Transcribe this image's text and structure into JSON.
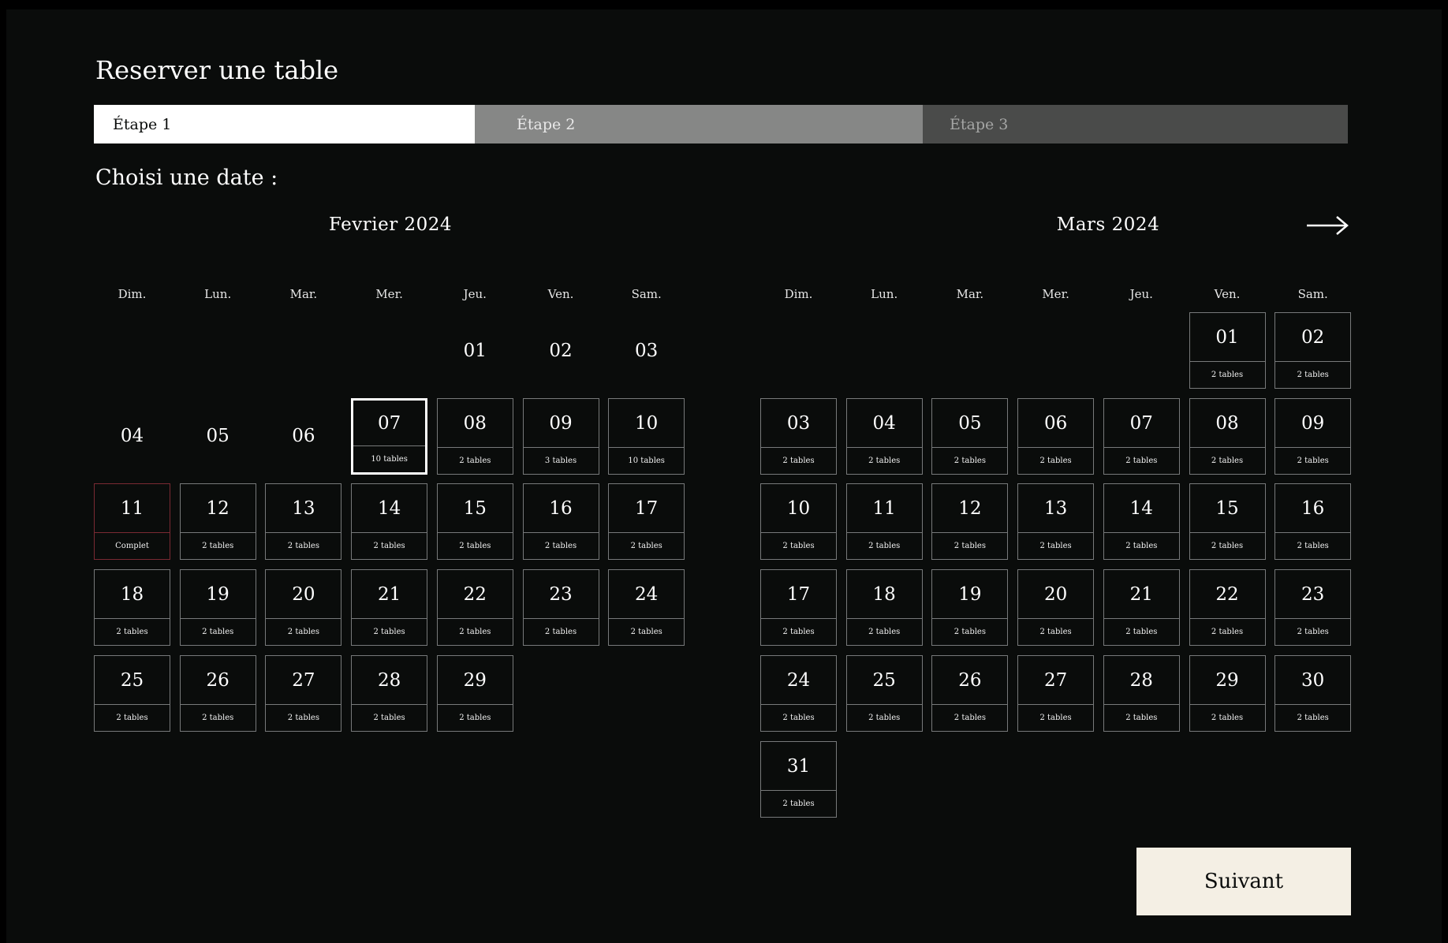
{
  "page": {
    "title": "Reserver une table",
    "subtitle": "Choisi une date :"
  },
  "steps": [
    {
      "label": "Étape 1",
      "state": "active"
    },
    {
      "label": "Étape 2",
      "state": "pending"
    },
    {
      "label": "Étape 3",
      "state": "pending"
    }
  ],
  "colors": {
    "background": "#0a0c0b",
    "cell_border": "#77797a",
    "full_border": "#7a2a33",
    "button_bg": "#f4efe4"
  },
  "calendar": {
    "weekdays": [
      "Dim.",
      "Lun.",
      "Mar.",
      "Mer.",
      "Jeu.",
      "Ven.",
      "Sam."
    ],
    "next_icon": "arrow-right-icon",
    "months": [
      {
        "title": "Fevrier 2024",
        "first_weekday": 4,
        "days": [
          {
            "day": "01",
            "available": false
          },
          {
            "day": "02",
            "available": false
          },
          {
            "day": "03",
            "available": false
          },
          {
            "day": "04",
            "available": false
          },
          {
            "day": "05",
            "available": false
          },
          {
            "day": "06",
            "available": false
          },
          {
            "day": "07",
            "status": "10 tables",
            "selected": true
          },
          {
            "day": "08",
            "status": "2 tables"
          },
          {
            "day": "09",
            "status": "3 tables"
          },
          {
            "day": "10",
            "status": "10 tables"
          },
          {
            "day": "11",
            "status": "Complet",
            "full": true
          },
          {
            "day": "12",
            "status": "2 tables"
          },
          {
            "day": "13",
            "status": "2 tables"
          },
          {
            "day": "14",
            "status": "2 tables"
          },
          {
            "day": "15",
            "status": "2 tables"
          },
          {
            "day": "16",
            "status": "2 tables"
          },
          {
            "day": "17",
            "status": "2 tables"
          },
          {
            "day": "18",
            "status": "2 tables"
          },
          {
            "day": "19",
            "status": "2 tables"
          },
          {
            "day": "20",
            "status": "2 tables"
          },
          {
            "day": "21",
            "status": "2 tables"
          },
          {
            "day": "22",
            "status": "2 tables"
          },
          {
            "day": "23",
            "status": "2 tables"
          },
          {
            "day": "24",
            "status": "2 tables"
          },
          {
            "day": "25",
            "status": "2 tables"
          },
          {
            "day": "26",
            "status": "2 tables"
          },
          {
            "day": "27",
            "status": "2 tables"
          },
          {
            "day": "28",
            "status": "2 tables"
          },
          {
            "day": "29",
            "status": "2 tables"
          }
        ]
      },
      {
        "title": "Mars 2024",
        "first_weekday": 5,
        "days": [
          {
            "day": "01",
            "status": "2 tables"
          },
          {
            "day": "02",
            "status": "2 tables"
          },
          {
            "day": "03",
            "status": "2 tables"
          },
          {
            "day": "04",
            "status": "2 tables"
          },
          {
            "day": "05",
            "status": "2 tables"
          },
          {
            "day": "06",
            "status": "2 tables"
          },
          {
            "day": "07",
            "status": "2 tables"
          },
          {
            "day": "08",
            "status": "2 tables"
          },
          {
            "day": "09",
            "status": "2 tables"
          },
          {
            "day": "10",
            "status": "2 tables"
          },
          {
            "day": "11",
            "status": "2 tables"
          },
          {
            "day": "12",
            "status": "2 tables"
          },
          {
            "day": "13",
            "status": "2 tables"
          },
          {
            "day": "14",
            "status": "2 tables"
          },
          {
            "day": "15",
            "status": "2 tables"
          },
          {
            "day": "16",
            "status": "2 tables"
          },
          {
            "day": "17",
            "status": "2 tables"
          },
          {
            "day": "18",
            "status": "2 tables"
          },
          {
            "day": "19",
            "status": "2 tables"
          },
          {
            "day": "20",
            "status": "2 tables"
          },
          {
            "day": "21",
            "status": "2 tables"
          },
          {
            "day": "22",
            "status": "2 tables"
          },
          {
            "day": "23",
            "status": "2 tables"
          },
          {
            "day": "24",
            "status": "2 tables"
          },
          {
            "day": "25",
            "status": "2 tables"
          },
          {
            "day": "26",
            "status": "2 tables"
          },
          {
            "day": "27",
            "status": "2 tables"
          },
          {
            "day": "28",
            "status": "2 tables"
          },
          {
            "day": "29",
            "status": "2 tables"
          },
          {
            "day": "30",
            "status": "2 tables"
          },
          {
            "day": "31",
            "status": "2 tables"
          }
        ]
      }
    ]
  },
  "footer": {
    "next_label": "Suivant"
  }
}
